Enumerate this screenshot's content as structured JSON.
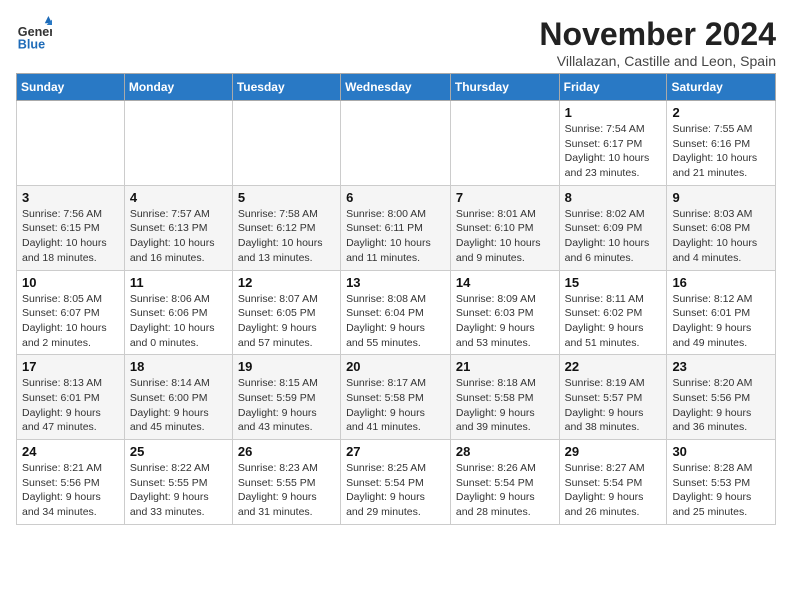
{
  "header": {
    "logo_general": "General",
    "logo_blue": "Blue",
    "month_title": "November 2024",
    "subtitle": "Villalazan, Castille and Leon, Spain"
  },
  "weekdays": [
    "Sunday",
    "Monday",
    "Tuesday",
    "Wednesday",
    "Thursday",
    "Friday",
    "Saturday"
  ],
  "weeks": [
    [
      {
        "day": "",
        "info": ""
      },
      {
        "day": "",
        "info": ""
      },
      {
        "day": "",
        "info": ""
      },
      {
        "day": "",
        "info": ""
      },
      {
        "day": "",
        "info": ""
      },
      {
        "day": "1",
        "info": "Sunrise: 7:54 AM\nSunset: 6:17 PM\nDaylight: 10 hours and 23 minutes."
      },
      {
        "day": "2",
        "info": "Sunrise: 7:55 AM\nSunset: 6:16 PM\nDaylight: 10 hours and 21 minutes."
      }
    ],
    [
      {
        "day": "3",
        "info": "Sunrise: 7:56 AM\nSunset: 6:15 PM\nDaylight: 10 hours and 18 minutes."
      },
      {
        "day": "4",
        "info": "Sunrise: 7:57 AM\nSunset: 6:13 PM\nDaylight: 10 hours and 16 minutes."
      },
      {
        "day": "5",
        "info": "Sunrise: 7:58 AM\nSunset: 6:12 PM\nDaylight: 10 hours and 13 minutes."
      },
      {
        "day": "6",
        "info": "Sunrise: 8:00 AM\nSunset: 6:11 PM\nDaylight: 10 hours and 11 minutes."
      },
      {
        "day": "7",
        "info": "Sunrise: 8:01 AM\nSunset: 6:10 PM\nDaylight: 10 hours and 9 minutes."
      },
      {
        "day": "8",
        "info": "Sunrise: 8:02 AM\nSunset: 6:09 PM\nDaylight: 10 hours and 6 minutes."
      },
      {
        "day": "9",
        "info": "Sunrise: 8:03 AM\nSunset: 6:08 PM\nDaylight: 10 hours and 4 minutes."
      }
    ],
    [
      {
        "day": "10",
        "info": "Sunrise: 8:05 AM\nSunset: 6:07 PM\nDaylight: 10 hours and 2 minutes."
      },
      {
        "day": "11",
        "info": "Sunrise: 8:06 AM\nSunset: 6:06 PM\nDaylight: 10 hours and 0 minutes."
      },
      {
        "day": "12",
        "info": "Sunrise: 8:07 AM\nSunset: 6:05 PM\nDaylight: 9 hours and 57 minutes."
      },
      {
        "day": "13",
        "info": "Sunrise: 8:08 AM\nSunset: 6:04 PM\nDaylight: 9 hours and 55 minutes."
      },
      {
        "day": "14",
        "info": "Sunrise: 8:09 AM\nSunset: 6:03 PM\nDaylight: 9 hours and 53 minutes."
      },
      {
        "day": "15",
        "info": "Sunrise: 8:11 AM\nSunset: 6:02 PM\nDaylight: 9 hours and 51 minutes."
      },
      {
        "day": "16",
        "info": "Sunrise: 8:12 AM\nSunset: 6:01 PM\nDaylight: 9 hours and 49 minutes."
      }
    ],
    [
      {
        "day": "17",
        "info": "Sunrise: 8:13 AM\nSunset: 6:01 PM\nDaylight: 9 hours and 47 minutes."
      },
      {
        "day": "18",
        "info": "Sunrise: 8:14 AM\nSunset: 6:00 PM\nDaylight: 9 hours and 45 minutes."
      },
      {
        "day": "19",
        "info": "Sunrise: 8:15 AM\nSunset: 5:59 PM\nDaylight: 9 hours and 43 minutes."
      },
      {
        "day": "20",
        "info": "Sunrise: 8:17 AM\nSunset: 5:58 PM\nDaylight: 9 hours and 41 minutes."
      },
      {
        "day": "21",
        "info": "Sunrise: 8:18 AM\nSunset: 5:58 PM\nDaylight: 9 hours and 39 minutes."
      },
      {
        "day": "22",
        "info": "Sunrise: 8:19 AM\nSunset: 5:57 PM\nDaylight: 9 hours and 38 minutes."
      },
      {
        "day": "23",
        "info": "Sunrise: 8:20 AM\nSunset: 5:56 PM\nDaylight: 9 hours and 36 minutes."
      }
    ],
    [
      {
        "day": "24",
        "info": "Sunrise: 8:21 AM\nSunset: 5:56 PM\nDaylight: 9 hours and 34 minutes."
      },
      {
        "day": "25",
        "info": "Sunrise: 8:22 AM\nSunset: 5:55 PM\nDaylight: 9 hours and 33 minutes."
      },
      {
        "day": "26",
        "info": "Sunrise: 8:23 AM\nSunset: 5:55 PM\nDaylight: 9 hours and 31 minutes."
      },
      {
        "day": "27",
        "info": "Sunrise: 8:25 AM\nSunset: 5:54 PM\nDaylight: 9 hours and 29 minutes."
      },
      {
        "day": "28",
        "info": "Sunrise: 8:26 AM\nSunset: 5:54 PM\nDaylight: 9 hours and 28 minutes."
      },
      {
        "day": "29",
        "info": "Sunrise: 8:27 AM\nSunset: 5:54 PM\nDaylight: 9 hours and 26 minutes."
      },
      {
        "day": "30",
        "info": "Sunrise: 8:28 AM\nSunset: 5:53 PM\nDaylight: 9 hours and 25 minutes."
      }
    ]
  ]
}
